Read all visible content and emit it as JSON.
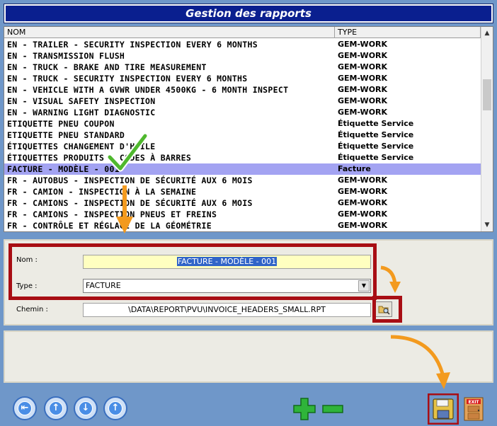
{
  "window": {
    "title": "Gestion des rapports"
  },
  "list": {
    "columns": [
      "NOM",
      "TYPE"
    ],
    "rows": [
      {
        "nom": "EN - TRAILER - SECURITY INSPECTION EVERY 6 MONTHS",
        "type": "GEM-WORK"
      },
      {
        "nom": "EN - TRANSMISSION FLUSH",
        "type": "GEM-WORK"
      },
      {
        "nom": "EN - TRUCK - BRAKE AND TIRE MEASUREMENT",
        "type": "GEM-WORK"
      },
      {
        "nom": "EN - TRUCK - SECURITY INSPECTION EVERY 6 MONTHS",
        "type": "GEM-WORK"
      },
      {
        "nom": "EN - VEHICLE WITH A GVWR UNDER 4500KG - 6 MONTH INSPECT",
        "type": "GEM-WORK"
      },
      {
        "nom": "EN - VISUAL SAFETY INSPECTION",
        "type": "GEM-WORK"
      },
      {
        "nom": "EN - WARNING LIGHT DIAGNOSTIC",
        "type": "GEM-WORK"
      },
      {
        "nom": "ETIQUETTE PNEU COUPON",
        "type": "Étiquette Service"
      },
      {
        "nom": "ETIQUETTE PNEU STANDARD",
        "type": "Étiquette Service"
      },
      {
        "nom": "ÉTIQUETTES CHANGEMENT D'HUILE",
        "type": "Étiquette Service"
      },
      {
        "nom": "ÉTIQUETTES PRODUITS - CODES À BARRES",
        "type": "Étiquette Service"
      },
      {
        "nom": "FACTURE - MODÈLE - 001",
        "type": "Facture"
      },
      {
        "nom": "FR - AUTOBUS - INSPECTION DE SÉCURITÉ AUX 6 MOIS",
        "type": "GEM-WORK"
      },
      {
        "nom": "FR - CAMION - INSPECTION À LA SEMAINE",
        "type": "GEM-WORK"
      },
      {
        "nom": "FR - CAMIONS - INSPECTION DE SÉCURITÉ AUX 6 MOIS",
        "type": "GEM-WORK"
      },
      {
        "nom": "FR - CAMIONS - INSPECTION PNEUS ET FREINS",
        "type": "GEM-WORK"
      },
      {
        "nom": "FR - CONTRÔLE ET RÉGLAGE DE LA GÉOMÉTRIE",
        "type": "GEM-WORK"
      }
    ],
    "selected_index": 11
  },
  "form": {
    "nom_label": "Nom :",
    "nom_value": "FACTURE - MODÈLE - 001",
    "type_label": "Type :",
    "type_value": "FACTURE",
    "chemin_label": "Chemin :",
    "chemin_value": "\\DATA\\REPORT\\PVU\\INVOICE_HEADERS_SMALL.RPT"
  },
  "icons": {
    "nav": [
      "first-icon",
      "previous-icon",
      "next-icon",
      "last-icon"
    ],
    "add": "plus-icon",
    "remove": "minus-icon",
    "save": "floppy-disk-icon",
    "exit": "exit-door-icon",
    "exit_text": "EXIT"
  },
  "colors": {
    "title_bg": "#0a1f8f",
    "selection": "#a3a3f2",
    "highlight": "#a80e14",
    "arrow": "#f39a1e"
  }
}
